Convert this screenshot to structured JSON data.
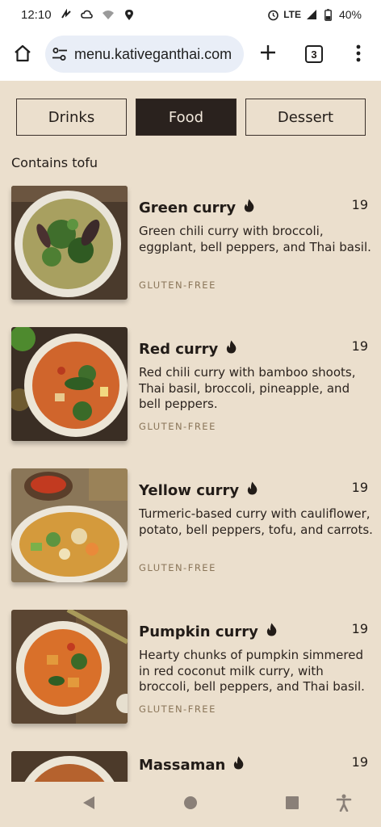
{
  "status": {
    "time": "12:10",
    "network": "LTE",
    "battery": "40%",
    "icons": [
      "nfc-icon",
      "cloud-icon",
      "wifi-icon",
      "location-icon",
      "alarm-icon",
      "signal-icon",
      "battery-icon"
    ]
  },
  "browser": {
    "url": "menu.kativeganthai.com",
    "tab_count": "3",
    "icons": [
      "home-icon",
      "tune-icon",
      "plus-icon",
      "tabs-icon",
      "more-vert-icon"
    ]
  },
  "categories": [
    {
      "label": "Drinks",
      "active": false
    },
    {
      "label": "Food",
      "active": true
    },
    {
      "label": "Dessert",
      "active": false
    }
  ],
  "section_title": "Contains tofu",
  "items": [
    {
      "name": "Green curry",
      "price": "19",
      "description": "Green chili curry with broccoli, eggplant, bell peppers, and Thai basil.",
      "tag": "GLUTEN-FREE",
      "spicy_icon": "flame-icon",
      "curry_color": "#a8a060"
    },
    {
      "name": "Red curry",
      "price": "19",
      "description": "Red chili curry with bamboo shoots, Thai basil, broccoli, pineapple, and bell peppers.",
      "tag": "GLUTEN-FREE",
      "spicy_icon": "flame-icon",
      "curry_color": "#d0652c"
    },
    {
      "name": "Yellow curry",
      "price": "19",
      "description": "Turmeric-based curry with cauliflower, potato, bell peppers, tofu, and carrots.",
      "tag": "GLUTEN-FREE",
      "spicy_icon": "flame-icon",
      "curry_color": "#d49a3c"
    },
    {
      "name": "Pumpkin curry",
      "price": "19",
      "description": "Hearty chunks of pumpkin simmered in red coconut milk curry, with broccoli, bell peppers, and Thai basil.",
      "tag": "GLUTEN-FREE",
      "spicy_icon": "flame-icon",
      "curry_color": "#d9702a"
    },
    {
      "name": "Massaman",
      "price": "19",
      "description": "",
      "tag": "",
      "spicy_icon": "flame-icon",
      "curry_color": "#b5622e"
    }
  ],
  "nav": [
    "back-icon",
    "home-circle-icon",
    "recents-icon",
    "accessibility-icon"
  ]
}
